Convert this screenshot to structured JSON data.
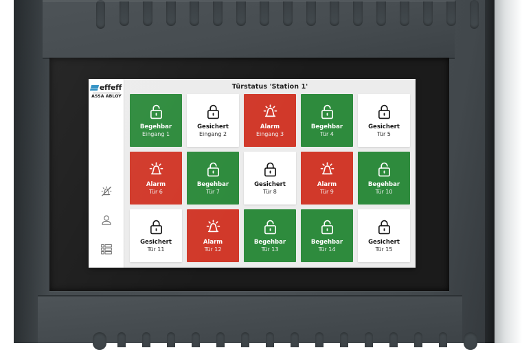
{
  "device": {
    "name": "wall-mounted-touch-terminal"
  },
  "brand": {
    "mark_color": "#2d8fc4",
    "name": "effeff",
    "group": "ASSA ABLOY"
  },
  "sidebar": {
    "items": [
      {
        "icon": "alarm-muted-icon",
        "label": ""
      },
      {
        "icon": "user-icon",
        "label": ""
      },
      {
        "icon": "list-icon",
        "label": ""
      }
    ]
  },
  "header": {
    "title": "Türstatus 'Station 1'"
  },
  "status_colors": {
    "green": "#2e8b3d",
    "red": "#d1392a",
    "white": "#ffffff"
  },
  "tiles": [
    {
      "status": "Begehbar",
      "name": "Eingang 1",
      "state": "green",
      "icon": "unlocked-padlock-icon"
    },
    {
      "status": "Gesichert",
      "name": "Eingang 2",
      "state": "white",
      "icon": "locked-padlock-icon"
    },
    {
      "status": "Alarm",
      "name": "Eingang 3",
      "state": "red",
      "icon": "alarm-siren-icon"
    },
    {
      "status": "Begehbar",
      "name": "Tür 4",
      "state": "green",
      "icon": "unlocked-padlock-icon"
    },
    {
      "status": "Gesichert",
      "name": "Tür 5",
      "state": "white",
      "icon": "locked-padlock-icon"
    },
    {
      "status": "Alarm",
      "name": "Tür 6",
      "state": "red",
      "icon": "alarm-siren-icon"
    },
    {
      "status": "Begehbar",
      "name": "Tür 7",
      "state": "green",
      "icon": "unlocked-padlock-icon"
    },
    {
      "status": "Gesichert",
      "name": "Tür 8",
      "state": "white",
      "icon": "locked-padlock-icon"
    },
    {
      "status": "Alarm",
      "name": "Tür 9",
      "state": "red",
      "icon": "alarm-siren-icon"
    },
    {
      "status": "Begehbar",
      "name": "Tür 10",
      "state": "green",
      "icon": "unlocked-padlock-icon"
    },
    {
      "status": "Gesichert",
      "name": "Tür 11",
      "state": "white",
      "icon": "locked-padlock-icon"
    },
    {
      "status": "Alarm",
      "name": "Tür 12",
      "state": "red",
      "icon": "alarm-siren-icon"
    },
    {
      "status": "Begehbar",
      "name": "Tür 13",
      "state": "green",
      "icon": "unlocked-padlock-icon"
    },
    {
      "status": "Begehbar",
      "name": "Tür 14",
      "state": "green",
      "icon": "unlocked-padlock-icon"
    },
    {
      "status": "Gesichert",
      "name": "Tür 15",
      "state": "white",
      "icon": "locked-padlock-icon"
    }
  ]
}
